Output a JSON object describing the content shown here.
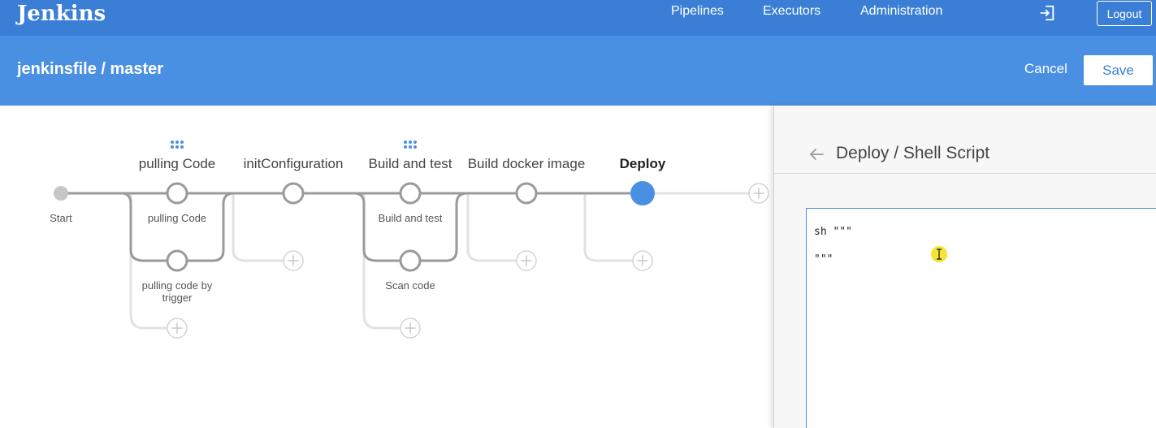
{
  "header": {
    "brand": "Jenkins",
    "nav": [
      "Pipelines",
      "Executors",
      "Administration"
    ],
    "exit_icon": "exit-icon",
    "logout_label": "Logout"
  },
  "subheader": {
    "title": "jenkinsfile / master",
    "cancel_label": "Cancel",
    "save_label": "Save"
  },
  "pipeline": {
    "start_label": "Start",
    "stages": [
      {
        "name": "pulling Code",
        "parallel": [
          "pulling Code",
          "pulling code by trigger"
        ]
      },
      {
        "name": "initConfiguration"
      },
      {
        "name": "Build and test",
        "parallel": [
          "Build and test",
          "Scan code"
        ]
      },
      {
        "name": "Build docker image"
      },
      {
        "name": "Deploy",
        "selected": true
      }
    ]
  },
  "panel": {
    "title": "Deploy / Shell Script",
    "script": "sh \"\"\"\n\"\"\""
  },
  "colors": {
    "topbar": "#3a7fd5",
    "subbar": "#4a90e2",
    "selected_node": "#4a90e2",
    "cursor_highlight": "#f5e431"
  }
}
